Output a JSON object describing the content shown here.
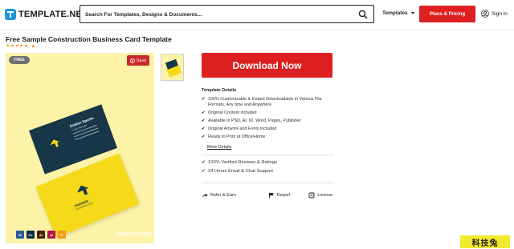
{
  "header": {
    "logo_text": "TEMPLATE.NET",
    "search_placeholder": "Search For Templates, Designs & Documents...",
    "templates_menu": "Templates",
    "plans_button": "Plans & Pricing",
    "signin": "Sign in"
  },
  "product": {
    "title": "Free Sample Construction Business Card Template",
    "stars": "★★★★★",
    "rating_icon": "flame-icon"
  },
  "preview": {
    "free_badge": "FREE",
    "save_label": "Save",
    "watermark": "TEMPLATE.NET",
    "card_name": "Emilon Sparks",
    "card_role": "Project Manager",
    "brand_name": "PREMIER",
    "brand_sub": "CONSTRUCTION",
    "apps": [
      {
        "name": "word-icon",
        "color": "#2b5797",
        "label": "W"
      },
      {
        "name": "photoshop-icon",
        "color": "#0b2a4a",
        "label": "Ps"
      },
      {
        "name": "illustrator-icon",
        "color": "#4a1d05",
        "label": "Ai"
      },
      {
        "name": "indesign-icon",
        "color": "#b0154d",
        "label": "Id"
      },
      {
        "name": "pages-icon",
        "color": "#f19a1b",
        "label": "P"
      }
    ]
  },
  "download_label": "Download Now",
  "details": {
    "title": "Template Details",
    "items": [
      "100% Customizable & Instant Downloadable in Various File Formats, Any time and Anywhere",
      "Original Content included",
      "Available in PSD, AI, ID, Word, Pages, Publisher",
      "Original Artwork and Fonts included",
      "Ready to Print at Office/Home"
    ],
    "more": "More Details"
  },
  "assurance": [
    "100% Verified Reviews & Ratings",
    "24 Hours Email & Chat Support"
  ],
  "actions": {
    "refer": "Refer & Earn",
    "report": "Report",
    "license": "License"
  },
  "corner_badge": "科技兔",
  "colors": {
    "accent_red": "#dd1f1f",
    "preview_bg": "#fdf3a8",
    "card_dark": "#173648",
    "card_yellow": "#f5da1a"
  }
}
